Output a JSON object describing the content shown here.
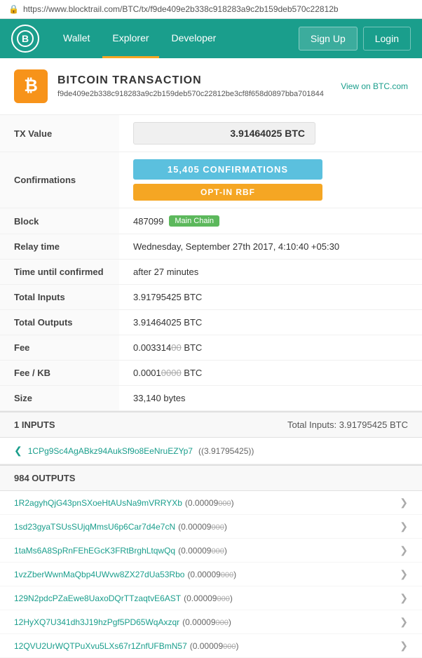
{
  "addressBar": {
    "lock": "🔒",
    "url": "https://www.blocktrail.com/BTC/tx/f9de409e2b338c918283a9c2b159deb570c22812b"
  },
  "nav": {
    "logo_symbol": "B",
    "links": [
      "Wallet",
      "Explorer",
      "Developer"
    ],
    "active_link": "Explorer",
    "right_buttons": [
      "Sign Up",
      "Login"
    ]
  },
  "transaction": {
    "icon_symbol": "₿",
    "title": "BITCOIN TRANSACTION",
    "view_link": "View on BTC.com",
    "hash": "f9de409e2b338c918283a9c2b159deb570c22812be3cf8f658d0897bba701844",
    "fields": {
      "tx_value_label": "TX Value",
      "tx_value": "3.91464025 BTC",
      "confirmations_label": "Confirmations",
      "confirmations": "15,405 CONFIRMATIONS",
      "opt_in_rbf": "OPT-IN RBF",
      "block_label": "Block",
      "block_number": "487099",
      "block_badge": "Main Chain",
      "relay_time_label": "Relay time",
      "relay_time": "Wednesday, September 27th 2017, 4:10:40 +05:30",
      "time_until_label": "Time until confirmed",
      "time_until": "after 27 minutes",
      "total_inputs_label": "Total Inputs",
      "total_inputs": "3.91795425 BTC",
      "total_outputs_label": "Total Outputs",
      "total_outputs": "3.91464025 BTC",
      "fee_label": "Fee",
      "fee_main": "0.003314",
      "fee_strike": "00",
      "fee_btc": " BTC",
      "fee_kb_label": "Fee / KB",
      "fee_kb_main": "0.0001",
      "fee_kb_strike": "0000",
      "fee_kb_btc": " BTC",
      "size_label": "Size",
      "size": "33,140 bytes"
    }
  },
  "inputs_section": {
    "label": "1 INPUTS",
    "total_label": "Total Inputs:",
    "total_value": "3.91795425 BTC",
    "items": [
      {
        "address": "1CPg9Sc4AgABkz94AukSf9o8EeNruEZYp7",
        "amount": "(3.91795425)"
      }
    ]
  },
  "outputs_section": {
    "label": "984 OUTPUTS",
    "items": [
      {
        "address": "1R2agyhQjG43pnSXoeHtAUsNa9mVRRYXb",
        "amount_main": "(0.00009",
        "amount_strike": "000",
        "amount_end": ")"
      },
      {
        "address": "1sd23gyaTSUsSUjqMmsU6p6Car7d4e7cN",
        "amount_main": "(0.00009",
        "amount_strike": "000",
        "amount_end": ")"
      },
      {
        "address": "1taMs6A8SpRnFEhEGcK3FRtBrghLtqwQq",
        "amount_main": "(0.00009",
        "amount_strike": "000",
        "amount_end": ")"
      },
      {
        "address": "1vzZberWwnMaQbp4UWvw8ZX27dUa53Rbo",
        "amount_main": "(0.00009",
        "amount_strike": "000",
        "amount_end": ")"
      },
      {
        "address": "129N2pdcPZaEwe8UaxoDQrTTzaqtvE6AST",
        "amount_main": "(0.00009",
        "amount_strike": "000",
        "amount_end": ")"
      },
      {
        "address": "12HyXQ7U341dh3J19hzPgf5PD65WqAxzqr",
        "amount_main": "(0.00009",
        "amount_strike": "000",
        "amount_end": ")"
      },
      {
        "address": "12QVU2UrWQTPuXvu5LXs67r1ZnfUFBmN57",
        "amount_main": "(0.00009",
        "amount_strike": "000",
        "amount_end": ")"
      }
    ]
  }
}
